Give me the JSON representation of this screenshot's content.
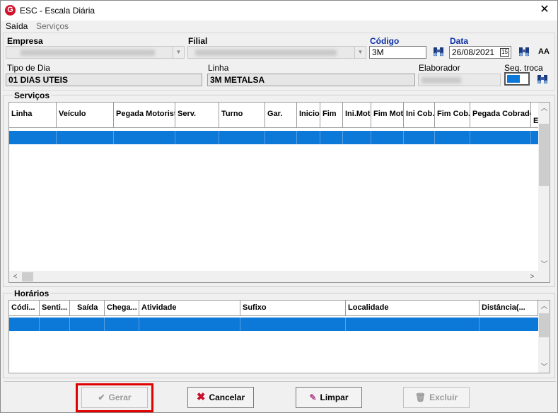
{
  "window": {
    "title": "ESC - Escala Diária",
    "app_icon_letter": "G",
    "close_glyph": "✕"
  },
  "menu": {
    "items": [
      "Saída",
      "Serviços"
    ]
  },
  "form": {
    "empresa_label": "Empresa",
    "filial_label": "Filial",
    "codigo_label": "Código",
    "codigo_value": "3M",
    "data_label": "Data",
    "data_value": "26/08/2021",
    "calendar_day": "15",
    "aa_glyph": "AA",
    "tipo_dia_label": "Tipo de Dia",
    "tipo_dia_value": "01 DIAS UTEIS",
    "linha_label": "Linha",
    "linha_value": "3M METALSA",
    "elaborador_label": "Elaborador",
    "seq_troca_label": "Seq. troca"
  },
  "servicos": {
    "title": "Serviços",
    "columns": [
      "Linha",
      "Veículo",
      "Pegada Motorista",
      "Serv.",
      "Turno",
      "Gar.",
      "Inicio",
      "Fim",
      "Ini.Mot.",
      "Fim Mot.",
      "Ini Cob.",
      "Fim Cob.",
      "Pegada Cobrador",
      "E"
    ]
  },
  "horarios": {
    "title": "Horários",
    "columns": [
      "Códi...",
      "Senti...",
      "Saída",
      "Chega...",
      "Atividade",
      "Sufixo",
      "Localidade",
      "Distância(..."
    ]
  },
  "buttons": {
    "gerar": "Gerar",
    "cancelar": "Cancelar",
    "limpar": "Limpar",
    "excluir": "Excluir"
  },
  "colors": {
    "selection": "#0c78d8",
    "accent_blue": "#0b2fa8",
    "highlight": "#e00000",
    "brand": "#d0122c"
  }
}
